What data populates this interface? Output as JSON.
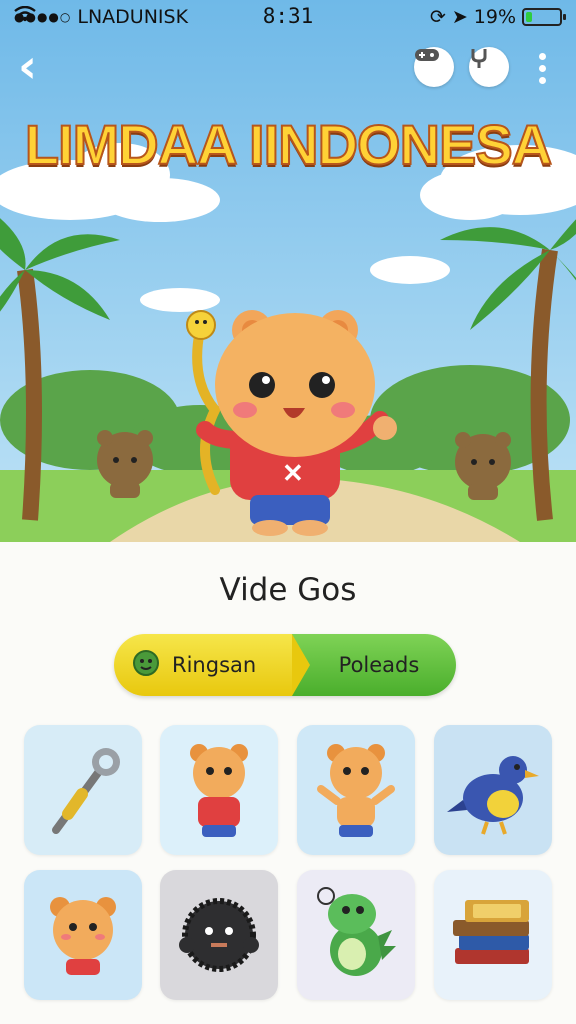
{
  "status_bar": {
    "carrier": "LNADUNISK",
    "time": "8:31",
    "battery": "19%",
    "battery_level": 0.19
  },
  "header": {
    "title": "LIMDAA IINDONESA"
  },
  "section": {
    "title": "Vide Gos"
  },
  "toggle": {
    "left_label": "Ringsan",
    "right_label": "Poleads"
  },
  "icons": {
    "back": "chevron-left-icon",
    "action1": "gamepad-icon",
    "action2": "tuning-fork-icon",
    "more": "more-vertical-icon"
  },
  "grid": {
    "items": [
      {
        "name": "wrench-item",
        "bg": "#d7ecf7"
      },
      {
        "name": "bear-red-shirt-item",
        "bg": "#dcf0fa"
      },
      {
        "name": "bear-waving-item",
        "bg": "#cfe8f7"
      },
      {
        "name": "blue-bird-item",
        "bg": "#c9e2f3"
      },
      {
        "name": "bear-face-item",
        "bg": "#cbe6f7"
      },
      {
        "name": "black-fuzzball-item",
        "bg": "#d9d8dc"
      },
      {
        "name": "green-dino-item",
        "bg": "#ecebf5"
      },
      {
        "name": "books-item",
        "bg": "#e8f2fa"
      }
    ]
  },
  "colors": {
    "sky": "#7ec3ea",
    "toggle_yellow": "#eed422",
    "toggle_green": "#5bbd3a",
    "title_fill": "#ffd236"
  }
}
